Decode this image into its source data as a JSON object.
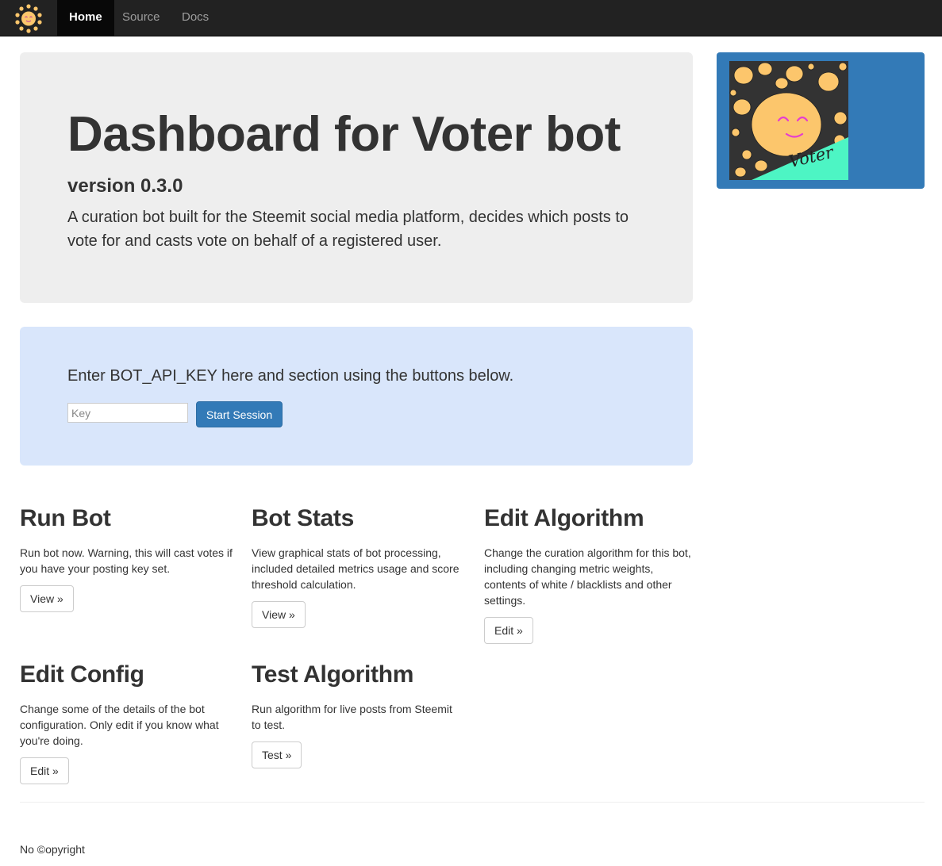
{
  "nav": {
    "items": [
      {
        "label": "Home",
        "active": true
      },
      {
        "label": "Source",
        "active": false
      },
      {
        "label": "Docs",
        "active": false
      }
    ]
  },
  "jumbotron": {
    "title": "Dashboard for Voter bot",
    "version": "version 0.3.0",
    "description": "A curation bot built for the Steemit social media platform, decides which posts to vote for and casts vote on behalf of a registered user."
  },
  "logo": {
    "caption": "Voter"
  },
  "session": {
    "prompt": "Enter BOT_API_KEY here and section using the buttons below.",
    "key_placeholder": "Key",
    "start_label": "Start Session"
  },
  "features": [
    {
      "title": "Run Bot",
      "text": "Run bot now. Warning, this will cast votes if you have your posting key set.",
      "button": "View »"
    },
    {
      "title": "Bot Stats",
      "text": "View graphical stats of bot processing, included detailed metrics usage and score threshold calculation.",
      "button": "View »"
    },
    {
      "title": "Edit Algorithm",
      "text": "Change the curation algorithm for this bot, including changing metric weights, contents of white / blacklists and other settings.",
      "button": "Edit »"
    },
    {
      "title": "Edit Config",
      "text": "Change some of the details of the bot configuration. Only edit if you know what you're doing.",
      "button": "Edit »"
    },
    {
      "title": "Test Algorithm",
      "text": "Run algorithm for live posts from Steemit to test.",
      "button": "Test »"
    }
  ],
  "footer": {
    "text": "No ©opyright"
  },
  "colors": {
    "navbar": "#222222",
    "primary": "#337ab7",
    "jumbotron": "#eeeeee",
    "session_bg": "#d9e6fb",
    "sun": "#fcc66c",
    "accent_green": "#4df5c4"
  }
}
